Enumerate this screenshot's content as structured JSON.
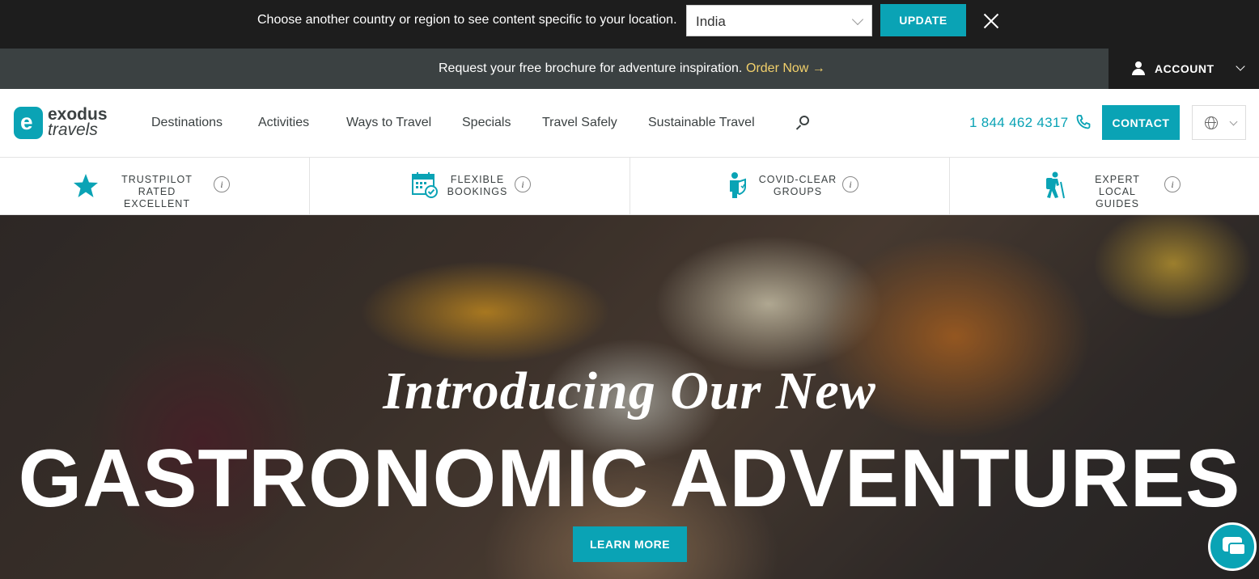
{
  "country_bar": {
    "message": "Choose another country or region to see content specific to your location.",
    "selected_country": "India",
    "update_label": "UPDATE"
  },
  "brochure_bar": {
    "text": "Request your free brochure for adventure inspiration.",
    "link_label": "Order Now →",
    "link_color": "#f2d06b"
  },
  "account": {
    "label": "ACCOUNT"
  },
  "logo": {
    "line1": "exodus",
    "line2": "travels"
  },
  "nav": {
    "items": [
      {
        "label": "Destinations"
      },
      {
        "label": "Activities"
      },
      {
        "label": "Ways to Travel"
      },
      {
        "label": "Specials"
      },
      {
        "label": "Travel Safely"
      },
      {
        "label": "Sustainable Travel"
      }
    ],
    "phone": "1 844 462 4317",
    "contact_label": "CONTACT"
  },
  "features": [
    {
      "line1": "TRUSTPILOT",
      "line2": "RATED EXCELLENT",
      "icon": "star-icon"
    },
    {
      "line1": "FLEXIBLE",
      "line2": "BOOKINGS",
      "icon": "calendar-check-icon"
    },
    {
      "line1": "COVID-CLEAR",
      "line2": "GROUPS",
      "icon": "person-shield-icon"
    },
    {
      "line1": "EXPERT LOCAL",
      "line2": "GUIDES",
      "icon": "hiker-icon"
    }
  ],
  "hero": {
    "intro": "Introducing Our New",
    "title": "GASTRONOMIC ADVENTURES",
    "cta_label": "LEARN MORE"
  },
  "colors": {
    "accent": "#0aa3b5",
    "dark": "#1d1d1d",
    "slate": "#3b4142"
  }
}
